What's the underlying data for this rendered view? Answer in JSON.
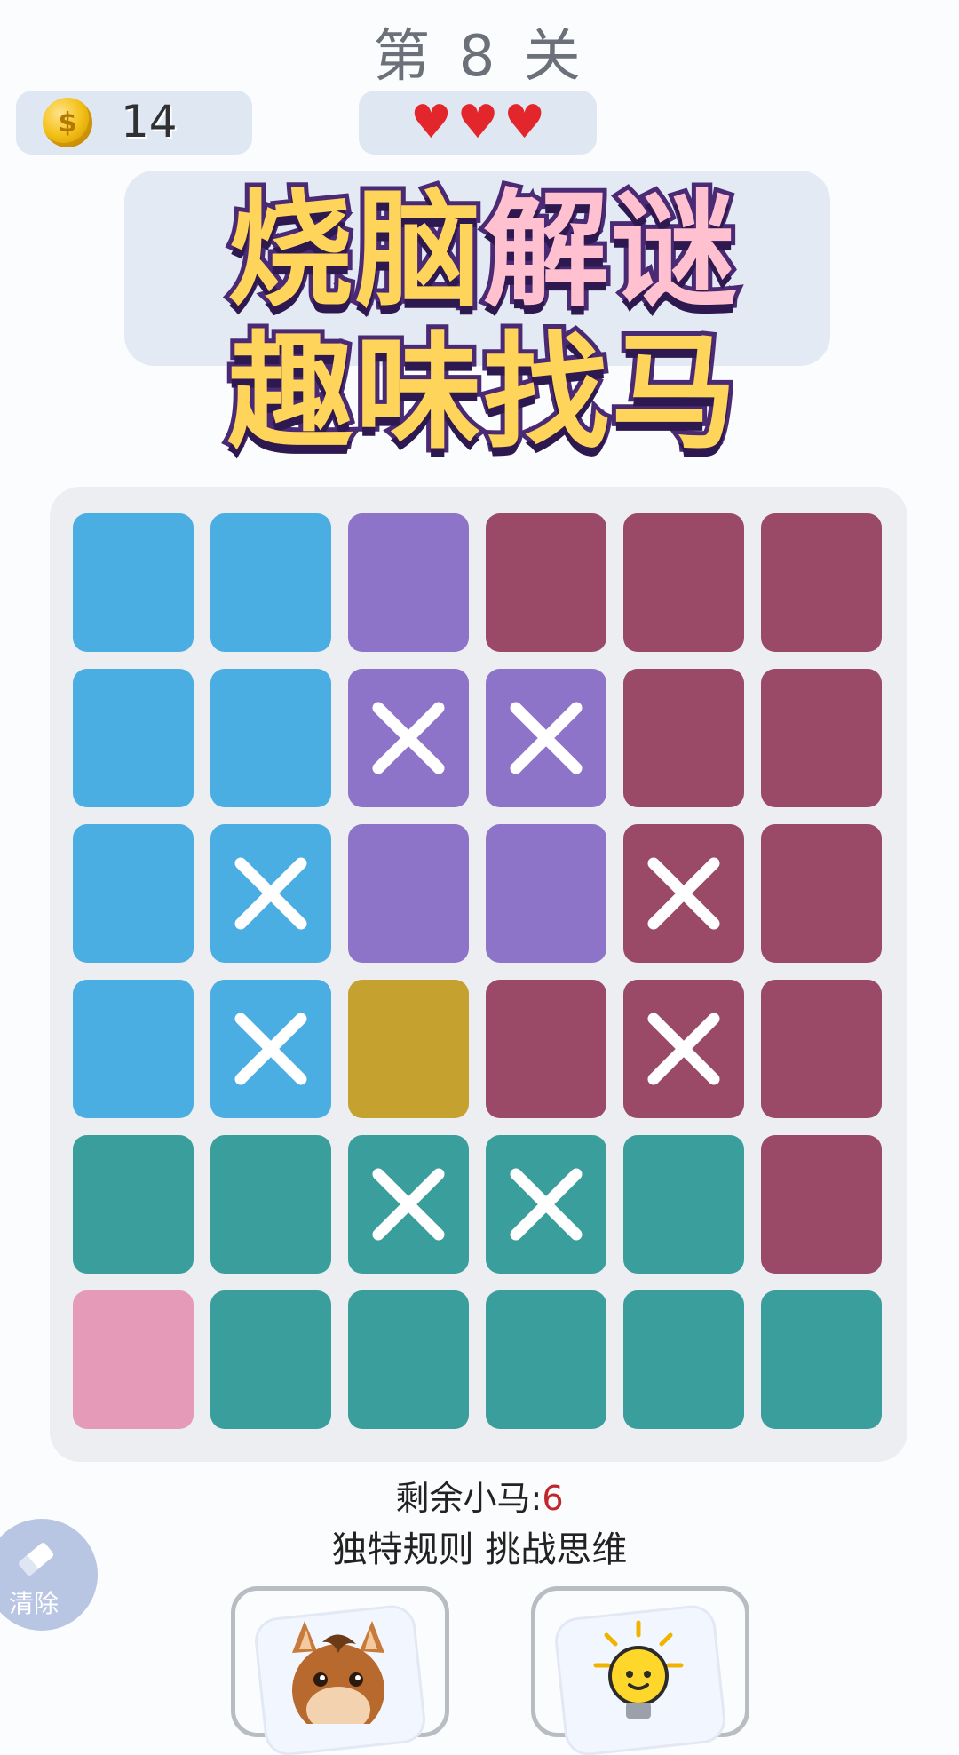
{
  "header": {
    "level_title": "第 8 关",
    "coins": "14",
    "coin_symbol": "$",
    "hearts": [
      "♥",
      "♥",
      "♥"
    ]
  },
  "banner": {
    "line1": [
      "烧脑",
      "解谜"
    ],
    "line2": "趣味找马"
  },
  "colors": {
    "blue": "#4aaee3",
    "purple": "#8e74c8",
    "maroon": "#9a4a67",
    "gold": "#c5a130",
    "teal": "#3a9e9c",
    "pink": "#e59ab7",
    "mark": "#ffffff"
  },
  "board": {
    "rows": 6,
    "cols": 6,
    "cells": [
      [
        "blue",
        "blue",
        "purple",
        "maroon",
        "maroon",
        "maroon"
      ],
      [
        "blue",
        "blue",
        "purple",
        "purple",
        "maroon",
        "maroon"
      ],
      [
        "blue",
        "blue",
        "purple",
        "purple",
        "maroon",
        "maroon"
      ],
      [
        "blue",
        "blue",
        "gold",
        "maroon",
        "maroon",
        "maroon"
      ],
      [
        "teal",
        "teal",
        "teal",
        "teal",
        "teal",
        "maroon"
      ],
      [
        "pink",
        "teal",
        "teal",
        "teal",
        "teal",
        "teal"
      ]
    ],
    "marks": [
      [
        false,
        false,
        false,
        false,
        false,
        false
      ],
      [
        false,
        false,
        true,
        true,
        false,
        false
      ],
      [
        false,
        true,
        false,
        false,
        true,
        false
      ],
      [
        false,
        true,
        false,
        false,
        true,
        false
      ],
      [
        false,
        false,
        true,
        true,
        false,
        false
      ],
      [
        false,
        false,
        false,
        false,
        false,
        false
      ]
    ]
  },
  "status": {
    "remaining_label": "剩余小马:",
    "remaining_count": "6",
    "slogan": "独特规则 挑战思维"
  },
  "tools": {
    "clear_label": "清除",
    "left_card_icon": "horse-icon",
    "right_card_icon": "lightbulb-icon"
  }
}
